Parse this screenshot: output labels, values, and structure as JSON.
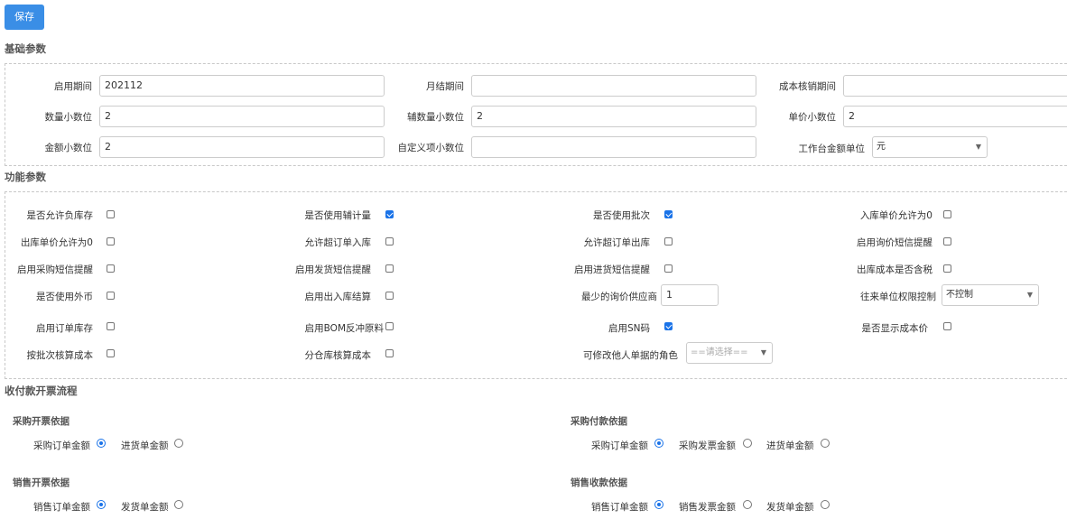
{
  "toolbar": {
    "save_label": "保存"
  },
  "sections": {
    "basic": "基础参数",
    "function": "功能参数",
    "flow": "收付款开票流程"
  },
  "basic": {
    "start_period_label": "启用期间",
    "start_period_value": "202112",
    "month_end_label": "月结期间",
    "month_end_value": "",
    "cost_period_label": "成本核销期间",
    "cost_period_value": "",
    "qty_decimal_label": "数量小数位",
    "qty_decimal_value": "2",
    "aux_qty_decimal_label": "辅数量小数位",
    "aux_qty_decimal_value": "2",
    "price_decimal_label": "单价小数位",
    "price_decimal_value": "2",
    "amount_decimal_label": "金额小数位",
    "amount_decimal_value": "2",
    "custom_decimal_label": "自定义项小数位",
    "custom_decimal_value": "",
    "workbench_unit_label": "工作台金额单位",
    "workbench_unit_value": "元"
  },
  "func": {
    "allow_negative_stock": "是否允许负库存",
    "allow_negative_stock_checked": false,
    "use_aux_qty": "是否使用辅计量",
    "use_aux_qty_checked": true,
    "use_batch": "是否使用批次",
    "use_batch_checked": true,
    "in_price_zero": "入库单价允许为0",
    "in_price_zero_checked": false,
    "out_price_zero": "出库单价允许为0",
    "out_price_zero_checked": false,
    "allow_over_order_in": "允许超订单入库",
    "allow_over_order_in_checked": false,
    "allow_over_order_out": "允许超订单出库",
    "allow_over_order_out_checked": false,
    "enable_inquiry_sms": "启用询价短信提醒",
    "enable_inquiry_sms_checked": false,
    "enable_purchase_sms": "启用采购短信提醒",
    "enable_purchase_sms_checked": false,
    "enable_delivery_sms": "启用发货短信提醒",
    "enable_delivery_sms_checked": false,
    "enable_receipt_sms": "启用进货短信提醒",
    "enable_receipt_sms_checked": false,
    "out_cost_tax": "出库成本是否含税",
    "out_cost_tax_checked": false,
    "use_foreign_currency": "是否使用外币",
    "use_foreign_currency_checked": false,
    "enable_inout_settlement": "启用出入库结算",
    "enable_inout_settlement_checked": false,
    "min_inquiry_suppliers": "最少的询价供应商",
    "min_inquiry_suppliers_value": "1",
    "partner_permission": "往来单位权限控制",
    "partner_permission_value": "不控制",
    "enable_order_stock": "启用订单库存",
    "enable_order_stock_checked": false,
    "enable_bom_backflush": "启用BOM反冲原料",
    "enable_bom_backflush_checked": false,
    "enable_sn": "启用SN码",
    "enable_sn_checked": true,
    "show_cost_price": "是否显示成本价",
    "show_cost_price_checked": false,
    "batch_cost": "按批次核算成本",
    "batch_cost_checked": false,
    "warehouse_cost": "分仓库核算成本",
    "warehouse_cost_checked": false,
    "modify_others_role": "可修改他人单据的角色",
    "modify_others_role_placeholder": "==请选择=="
  },
  "flow": {
    "purchase_invoice": {
      "title": "采购开票依据",
      "options": [
        "采购订单金额",
        "进货单金额"
      ],
      "selected": 0
    },
    "purchase_payment": {
      "title": "采购付款依据",
      "options": [
        "采购订单金额",
        "采购发票金额",
        "进货单金额"
      ],
      "selected": 0
    },
    "sales_invoice": {
      "title": "销售开票依据",
      "options": [
        "销售订单金额",
        "发货单金额"
      ],
      "selected": 0
    },
    "sales_receipt": {
      "title": "销售收款依据",
      "options": [
        "销售订单金额",
        "销售发票金额",
        "发货单金额"
      ],
      "selected": 0
    }
  },
  "colors": {
    "primary": "#3a8ee6",
    "checked": "#1a73e8",
    "border": "#cccccc"
  }
}
